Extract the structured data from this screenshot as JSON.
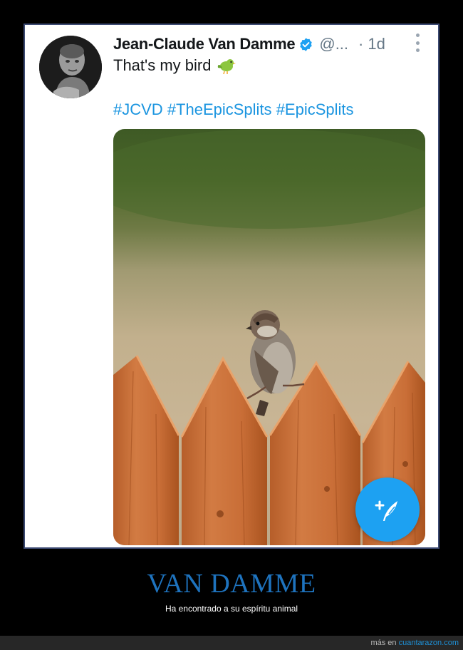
{
  "tweet": {
    "display_name": "Jean-Claude Van Damme",
    "handle": "@...",
    "separator": "·",
    "timestamp": "1d",
    "text": "That's my bird",
    "emoji": "bird-emoji",
    "hashtags": [
      "#JCVD",
      "#TheEpicSplits",
      "#EpicSplits"
    ],
    "verified": true,
    "colors": {
      "accent": "#1da1f2",
      "hashtag": "#1b95e0",
      "name": "#14171a",
      "muted": "#657786"
    }
  },
  "photo": {
    "subject": "sparrow-on-fence-photo"
  },
  "compose_button": {
    "icon": "compose-feather-icon"
  },
  "meme": {
    "title": "VAN DAMME",
    "subtitle": "Ha encontrado a su espíritu animal",
    "title_color": "#1e73be"
  },
  "footer": {
    "prefix": "más en",
    "site": "cuantarazon.com"
  }
}
